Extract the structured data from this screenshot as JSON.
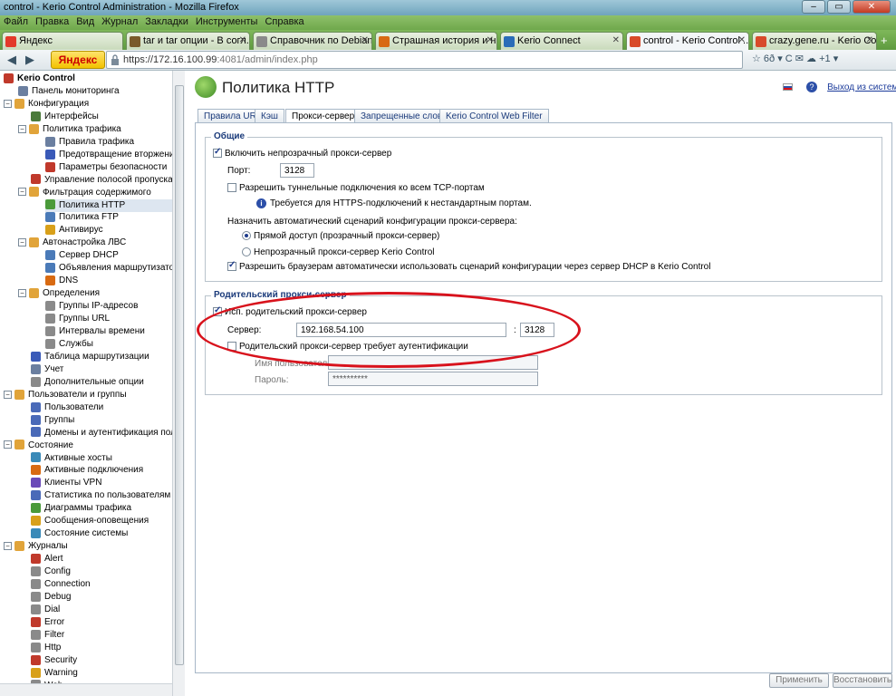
{
  "browser": {
    "window_title": "control - Kerio Control Administration - Mozilla Firefox",
    "menu": [
      "Файл",
      "Правка",
      "Вид",
      "Журнал",
      "Закладки",
      "Инструменты",
      "Справка"
    ],
    "tabs": [
      {
        "label": "Яндекс",
        "color": "#e33a2a"
      },
      {
        "label": "tar и tar опции - В согл...",
        "color": "#7a5a2a"
      },
      {
        "label": "Справочник по Debian...",
        "color": "#8a8a8a"
      },
      {
        "label": "Страшная история и н...",
        "color": "#d86a12"
      },
      {
        "label": "Kerio Connect",
        "color": "#2a6cb8"
      },
      {
        "label": "control - Kerio Control ...",
        "color": "#d84a2a"
      },
      {
        "label": "crazy.gene.ru - Kerio Co...",
        "color": "#d84a2a"
      }
    ],
    "yandex_button": "Яндекс",
    "url_host": "https://172.16.100.99",
    "url_rest": ":4081/admin/index.php",
    "nav_right": "☆ 6ð ▾ C   ✉  ☁ +1   ▾"
  },
  "sidebar": {
    "items": [
      {
        "label": "Kerio Control",
        "indent": 0,
        "toggle": "",
        "color": "#c0392b",
        "bold": true
      },
      {
        "label": "Панель мониторинга",
        "indent": 1,
        "toggle": "",
        "color": "#6b7fa0"
      },
      {
        "label": "Конфигурация",
        "indent": 0,
        "toggle": "−",
        "color": "#e1a43a"
      },
      {
        "label": "Интерфейсы",
        "indent": 2,
        "toggle": "",
        "color": "#4a7a3a"
      },
      {
        "label": "Политика трафика",
        "indent": 1,
        "toggle": "−",
        "color": "#e1a43a"
      },
      {
        "label": "Правила трафика",
        "indent": 3,
        "toggle": "",
        "color": "#6b7fa0"
      },
      {
        "label": "Предотвращение вторжения",
        "indent": 3,
        "toggle": "",
        "color": "#3a5ab8"
      },
      {
        "label": "Параметры безопасности",
        "indent": 3,
        "toggle": "",
        "color": "#c0392b"
      },
      {
        "label": "Управление полосой пропускания и",
        "indent": 2,
        "toggle": "",
        "color": "#c0392b"
      },
      {
        "label": "Фильтрация содержимого",
        "indent": 1,
        "toggle": "−",
        "color": "#e1a43a"
      },
      {
        "label": "Политика HTTP",
        "indent": 3,
        "toggle": "",
        "color": "#4a9a3a",
        "selected": true
      },
      {
        "label": "Политика FTP",
        "indent": 3,
        "toggle": "",
        "color": "#4a7ab8"
      },
      {
        "label": "Антивирус",
        "indent": 3,
        "toggle": "",
        "color": "#d8a01a"
      },
      {
        "label": "Автонастройка ЛВС",
        "indent": 1,
        "toggle": "−",
        "color": "#e1a43a"
      },
      {
        "label": "Сервер DHCP",
        "indent": 3,
        "toggle": "",
        "color": "#4a7ab8"
      },
      {
        "label": "Объявления маршрутизатора II",
        "indent": 3,
        "toggle": "",
        "color": "#4a7ab8"
      },
      {
        "label": "DNS",
        "indent": 3,
        "toggle": "",
        "color": "#d86a12"
      },
      {
        "label": "Определения",
        "indent": 1,
        "toggle": "−",
        "color": "#e1a43a"
      },
      {
        "label": "Группы IP-адресов",
        "indent": 3,
        "toggle": "",
        "color": "#8a8a8a"
      },
      {
        "label": "Группы URL",
        "indent": 3,
        "toggle": "",
        "color": "#8a8a8a"
      },
      {
        "label": "Интервалы времени",
        "indent": 3,
        "toggle": "",
        "color": "#8a8a8a"
      },
      {
        "label": "Службы",
        "indent": 3,
        "toggle": "",
        "color": "#8a8a8a"
      },
      {
        "label": "Таблица маршрутизации",
        "indent": 2,
        "toggle": "",
        "color": "#3a5ab8"
      },
      {
        "label": "Учет",
        "indent": 2,
        "toggle": "",
        "color": "#6b7fa0"
      },
      {
        "label": "Дополнительные опции",
        "indent": 2,
        "toggle": "",
        "color": "#8a8a8a"
      },
      {
        "label": "Пользователи и группы",
        "indent": 0,
        "toggle": "−",
        "color": "#e1a43a"
      },
      {
        "label": "Пользователи",
        "indent": 2,
        "toggle": "",
        "color": "#4a6ab8"
      },
      {
        "label": "Группы",
        "indent": 2,
        "toggle": "",
        "color": "#4a6ab8"
      },
      {
        "label": "Домены и аутентификация пользов",
        "indent": 2,
        "toggle": "",
        "color": "#4a6ab8"
      },
      {
        "label": "Состояние",
        "indent": 0,
        "toggle": "−",
        "color": "#e1a43a"
      },
      {
        "label": "Активные хосты",
        "indent": 2,
        "toggle": "",
        "color": "#3a8ab8"
      },
      {
        "label": "Активные подключения",
        "indent": 2,
        "toggle": "",
        "color": "#d86a12"
      },
      {
        "label": "Клиенты VPN",
        "indent": 2,
        "toggle": "",
        "color": "#6a4ab8"
      },
      {
        "label": "Статистика по пользователям",
        "indent": 2,
        "toggle": "",
        "color": "#4a6ab8"
      },
      {
        "label": "Диаграммы трафика",
        "indent": 2,
        "toggle": "",
        "color": "#4a9a3a"
      },
      {
        "label": "Сообщения-оповещения",
        "indent": 2,
        "toggle": "",
        "color": "#d8a01a"
      },
      {
        "label": "Состояние системы",
        "indent": 2,
        "toggle": "",
        "color": "#3a8ab8"
      },
      {
        "label": "Журналы",
        "indent": 0,
        "toggle": "−",
        "color": "#e1a43a"
      },
      {
        "label": "Alert",
        "indent": 2,
        "toggle": "",
        "color": "#c0392b"
      },
      {
        "label": "Config",
        "indent": 2,
        "toggle": "",
        "color": "#8a8a8a"
      },
      {
        "label": "Connection",
        "indent": 2,
        "toggle": "",
        "color": "#8a8a8a"
      },
      {
        "label": "Debug",
        "indent": 2,
        "toggle": "",
        "color": "#8a8a8a"
      },
      {
        "label": "Dial",
        "indent": 2,
        "toggle": "",
        "color": "#8a8a8a"
      },
      {
        "label": "Error",
        "indent": 2,
        "toggle": "",
        "color": "#c0392b"
      },
      {
        "label": "Filter",
        "indent": 2,
        "toggle": "",
        "color": "#8a8a8a"
      },
      {
        "label": "Http",
        "indent": 2,
        "toggle": "",
        "color": "#8a8a8a"
      },
      {
        "label": "Security",
        "indent": 2,
        "toggle": "",
        "color": "#c0392b"
      },
      {
        "label": "Warning",
        "indent": 2,
        "toggle": "",
        "color": "#d8a01a"
      },
      {
        "label": "Web",
        "indent": 2,
        "toggle": "",
        "color": "#8a8a8a"
      }
    ]
  },
  "header": {
    "title": "Политика HTTP",
    "logout": "Выход из системы"
  },
  "content_tabs": [
    "Правила URL",
    "Кэш",
    "Прокси-сервер",
    "Запрещенные слова",
    "Kerio Control Web Filter"
  ],
  "general": {
    "legend": "Общие",
    "enable_proxy": "Включить непрозрачный прокси-сервер",
    "port_label": "Порт:",
    "port_value": "3128",
    "allow_tunnel": "Разрешить туннельные подключения ко всем TCP-портам",
    "https_note": "Требуется для HTTPS-подключений к нестандартным портам.",
    "auto_script_label": "Назначить автоматический сценарий конфигурации прокси-сервера:",
    "radio_direct": "Прямой доступ (прозрачный прокси-сервер)",
    "radio_nontransparent": "Непрозрачный прокси-сервер Kerio Control",
    "allow_dhcp": "Разрешить браузерам автоматически использовать сценарий конфигурации через сервер DHCP в Kerio Control"
  },
  "parent": {
    "legend": "Родительский прокси-сервер",
    "use_parent": "Исп. родительский прокси-сервер",
    "server_label": "Сервер:",
    "server_value": "192.168.54.100",
    "colon": ":",
    "server_port": "3128",
    "requires_auth": "Родительский прокси-сервер требует аутентификации",
    "username_label": "Имя пользователя:",
    "username_value": "",
    "password_label": "Пароль:",
    "password_value": "**********"
  },
  "buttons": {
    "apply": "Применить",
    "restore": "Восстановить"
  },
  "colors": {
    "annotation_ellipse": "#d8121c",
    "accent": "#1a3a7a"
  }
}
